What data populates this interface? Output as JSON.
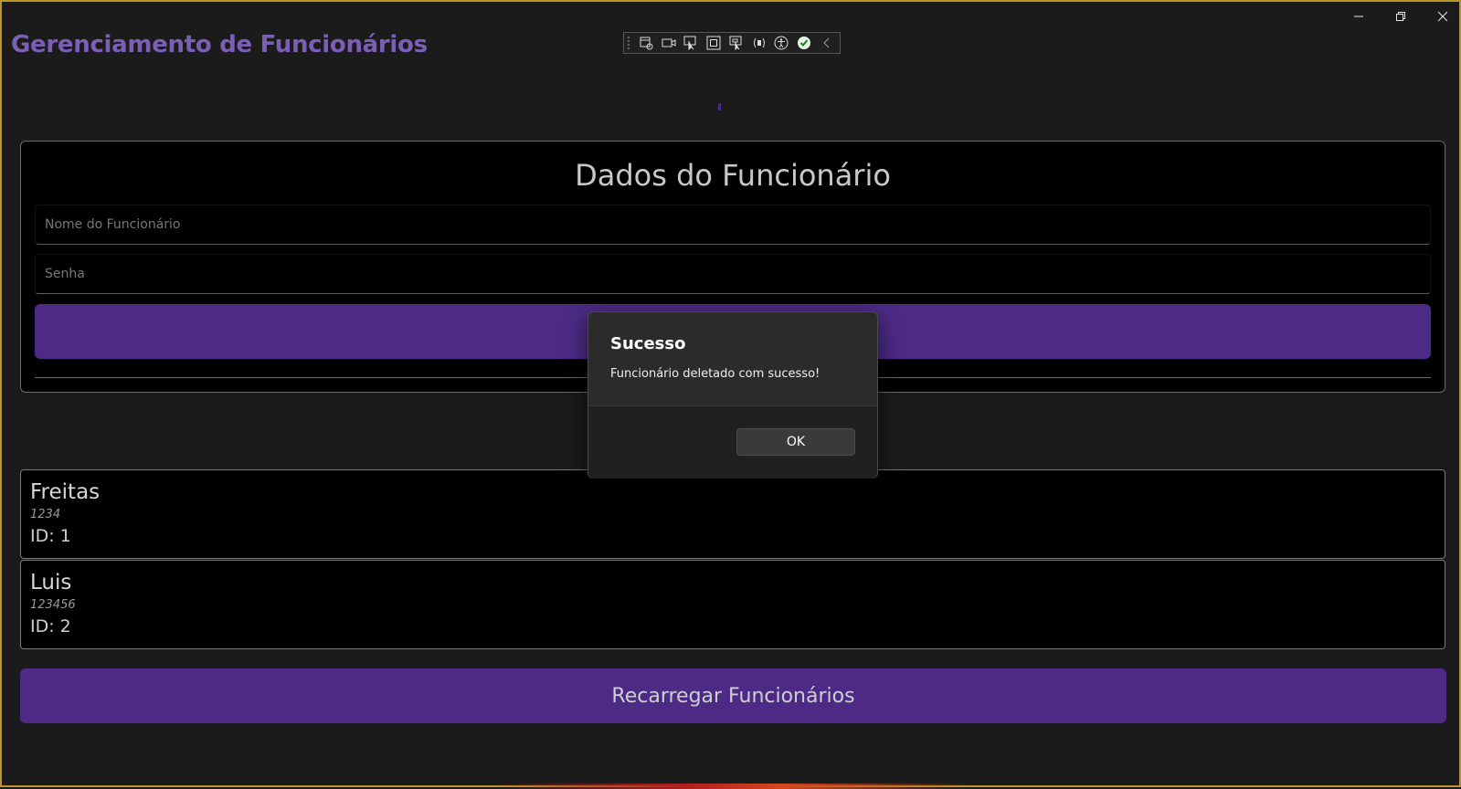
{
  "window": {
    "caption_buttons": {
      "minimize_icon": "minimize-icon",
      "restore_icon": "restore-icon",
      "close_icon": "close-icon"
    }
  },
  "app": {
    "title": "Gerenciamento de Funcionários"
  },
  "devtools_toolbar": {
    "icons": [
      "live-visual-tree-icon",
      "video-icon",
      "select-element-icon",
      "display-layout-adorners-icon",
      "track-focus-icon",
      "binding-failures-icon",
      "accessibility-checker-icon",
      "hot-reload-status-icon",
      "collapse-icon"
    ]
  },
  "form": {
    "title": "Dados do Funcionário",
    "name_placeholder": "Nome do Funcionário",
    "password_placeholder": "Senha"
  },
  "employees": [
    {
      "name": "Freitas",
      "password": "1234",
      "id": "ID: 1"
    },
    {
      "name": "Luis",
      "password": "123456",
      "id": "ID: 2"
    }
  ],
  "reload_button": {
    "label": "Recarregar Funcionários"
  },
  "dialog": {
    "title": "Sucesso",
    "message": "Funcionário deletado com sucesso!",
    "ok_label": "OK"
  },
  "colors": {
    "accent": "#4c2a85",
    "title": "#7b5fb5",
    "window_border": "#b9952c"
  }
}
